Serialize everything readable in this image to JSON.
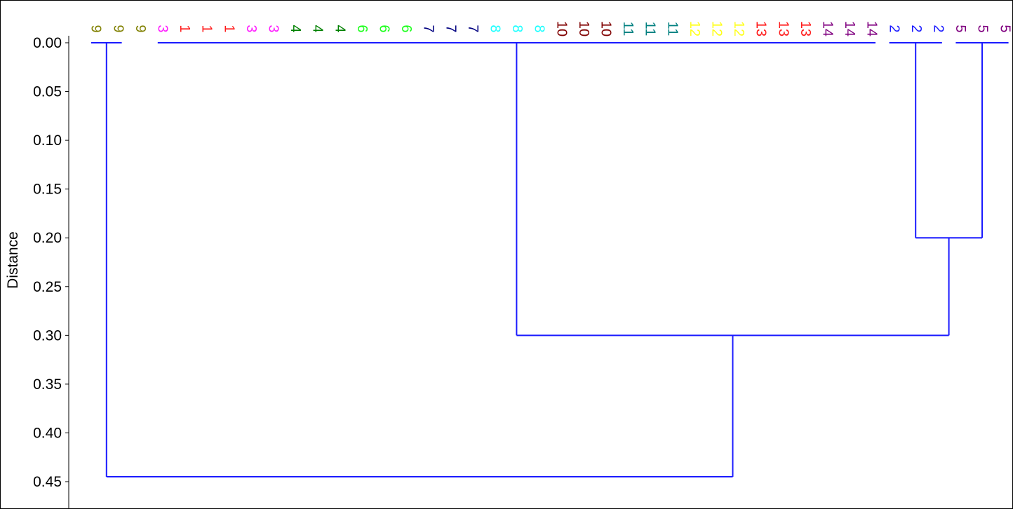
{
  "chart_data": {
    "type": "dendrogram",
    "ylabel": "Distance",
    "ylim": [
      0.0,
      0.45
    ],
    "yticks": [
      "0.00",
      "0.05",
      "0.10",
      "0.15",
      "0.20",
      "0.25",
      "0.30",
      "0.35",
      "0.40",
      "0.45"
    ],
    "yaxis_inverted": true,
    "link_color": "#1a1aff",
    "leaves": [
      {
        "label": "9",
        "color": "#808000"
      },
      {
        "label": "9",
        "color": "#808000"
      },
      {
        "label": "9",
        "color": "#808000"
      },
      {
        "label": "3",
        "color": "#ff1aff"
      },
      {
        "label": "1",
        "color": "#ff1a1a"
      },
      {
        "label": "1",
        "color": "#ff1a1a"
      },
      {
        "label": "1",
        "color": "#ff1a1a"
      },
      {
        "label": "3",
        "color": "#ff1aff"
      },
      {
        "label": "3",
        "color": "#ff1aff"
      },
      {
        "label": "4",
        "color": "#008000"
      },
      {
        "label": "4",
        "color": "#008000"
      },
      {
        "label": "4",
        "color": "#008000"
      },
      {
        "label": "6",
        "color": "#1aff1a"
      },
      {
        "label": "6",
        "color": "#1aff1a"
      },
      {
        "label": "6",
        "color": "#1aff1a"
      },
      {
        "label": "7",
        "color": "#000080"
      },
      {
        "label": "7",
        "color": "#000080"
      },
      {
        "label": "7",
        "color": "#000080"
      },
      {
        "label": "8",
        "color": "#1affff"
      },
      {
        "label": "8",
        "color": "#1affff"
      },
      {
        "label": "8",
        "color": "#1affff"
      },
      {
        "label": "10",
        "color": "#800000"
      },
      {
        "label": "10",
        "color": "#800000"
      },
      {
        "label": "10",
        "color": "#800000"
      },
      {
        "label": "11",
        "color": "#008080"
      },
      {
        "label": "11",
        "color": "#008080"
      },
      {
        "label": "11",
        "color": "#008080"
      },
      {
        "label": "12",
        "color": "#ffff1a"
      },
      {
        "label": "12",
        "color": "#ffff1a"
      },
      {
        "label": "12",
        "color": "#ffff1a"
      },
      {
        "label": "13",
        "color": "#ff1a1a"
      },
      {
        "label": "13",
        "color": "#ff1a1a"
      },
      {
        "label": "13",
        "color": "#ff1a1a"
      },
      {
        "label": "14",
        "color": "#800080"
      },
      {
        "label": "14",
        "color": "#800080"
      },
      {
        "label": "14",
        "color": "#800080"
      },
      {
        "label": "2",
        "color": "#1a1aff"
      },
      {
        "label": "2",
        "color": "#1a1aff"
      },
      {
        "label": "2",
        "color": "#1a1aff"
      },
      {
        "label": "5",
        "color": "#800080"
      },
      {
        "label": "5",
        "color": "#800080"
      },
      {
        "label": "5",
        "color": "#800080"
      }
    ],
    "clusters": [
      {
        "name": "g9",
        "leaves": [
          0,
          1,
          2
        ],
        "height": 0.0
      },
      {
        "name": "gbig",
        "leaves": [
          3,
          35
        ],
        "height": 0.0
      },
      {
        "name": "g2",
        "leaves": [
          36,
          38
        ],
        "height": 0.0
      },
      {
        "name": "g5",
        "leaves": [
          39,
          41
        ],
        "height": 0.0
      }
    ],
    "merges": [
      {
        "id": "m25",
        "left": "g2",
        "right": "g5",
        "height": 0.2
      },
      {
        "id": "m14",
        "left": "gbig",
        "right": "m25",
        "height": 0.3
      },
      {
        "id": "root",
        "left": "g9",
        "right": "m14",
        "height": 0.445
      }
    ]
  }
}
